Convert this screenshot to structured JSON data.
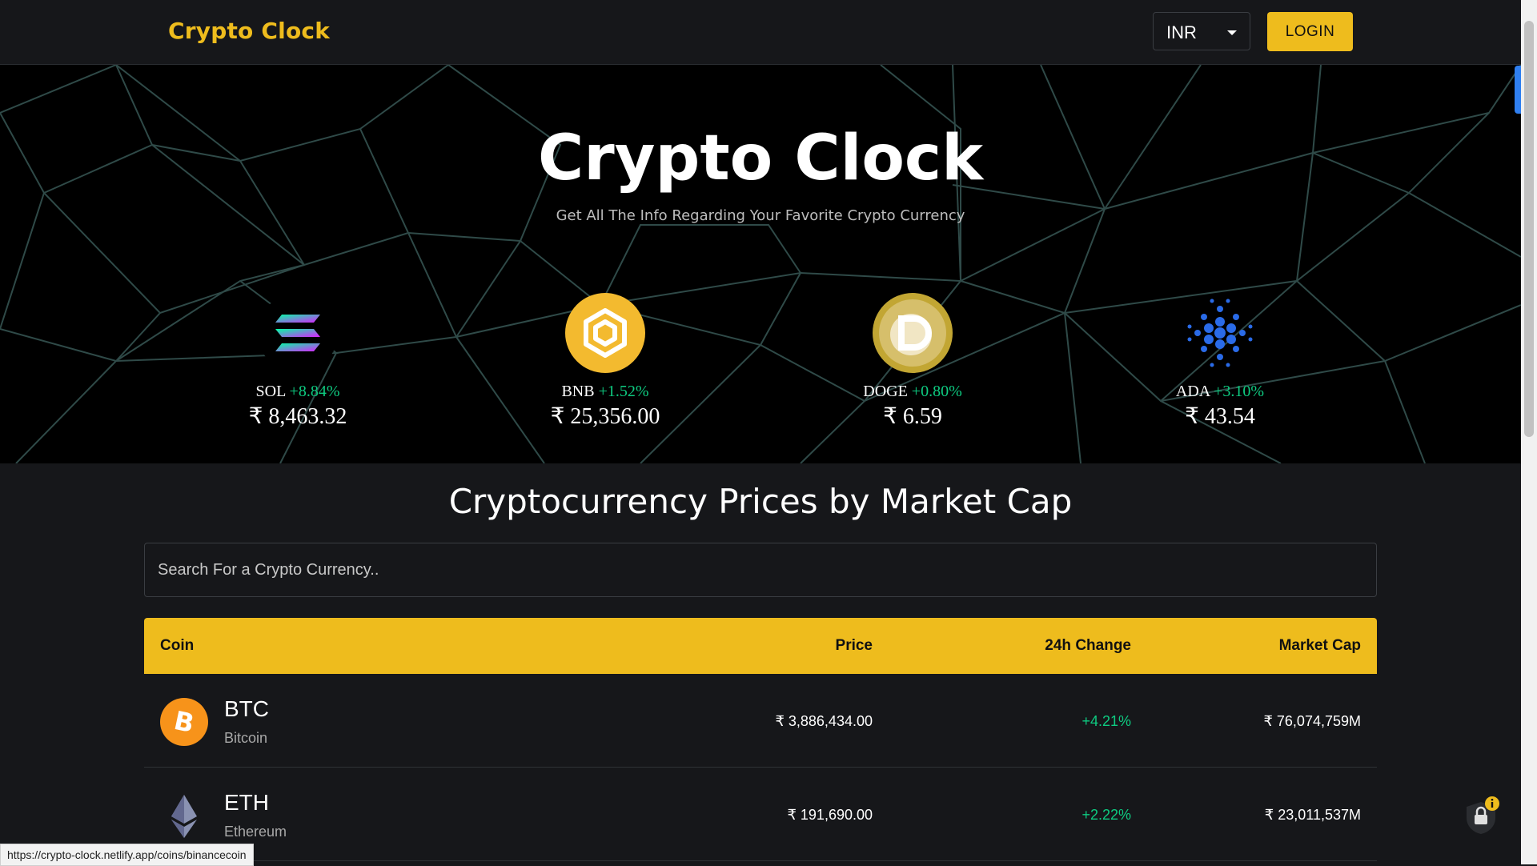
{
  "header": {
    "brand": "Crypto Clock",
    "currency": "INR",
    "login_label": "LOGIN"
  },
  "banner": {
    "title": "Crypto Clock",
    "subtitle": "Get All The Info Regarding Your Favorite Crypto Currency"
  },
  "carousel": [
    {
      "symbol": "SOL",
      "change": "+8.84%",
      "price": "₹ 8,463.32",
      "icon": "solana-logo-icon"
    },
    {
      "symbol": "BNB",
      "change": "+1.52%",
      "price": "₹ 25,356.00",
      "icon": "binance-logo-icon"
    },
    {
      "symbol": "DOGE",
      "change": "+0.80%",
      "price": "₹ 6.59",
      "icon": "dogecoin-logo-icon"
    },
    {
      "symbol": "ADA",
      "change": "+3.10%",
      "price": "₹ 43.54",
      "icon": "cardano-logo-icon"
    }
  ],
  "section": {
    "title": "Cryptocurrency Prices by Market Cap",
    "search_placeholder": "Search For a Crypto Currency.."
  },
  "table": {
    "headers": [
      "Coin",
      "Price",
      "24h Change",
      "Market Cap"
    ],
    "rows": [
      {
        "symbol": "BTC",
        "name": "Bitcoin",
        "price": "₹ 3,886,434.00",
        "change": "+4.21%",
        "market_cap": "₹ 76,074,759M",
        "icon": "bitcoin-logo-icon"
      },
      {
        "symbol": "ETH",
        "name": "Ethereum",
        "price": "₹ 191,690.00",
        "change": "+2.22%",
        "market_cap": "₹ 23,011,537M",
        "icon": "ethereum-logo-icon"
      }
    ]
  },
  "status_bar": {
    "url": "https://crypto-clock.netlify.app/coins/binancecoin"
  },
  "colors": {
    "accent": "#eebc1d",
    "positive": "#0ecb81",
    "background": "#16171a"
  }
}
